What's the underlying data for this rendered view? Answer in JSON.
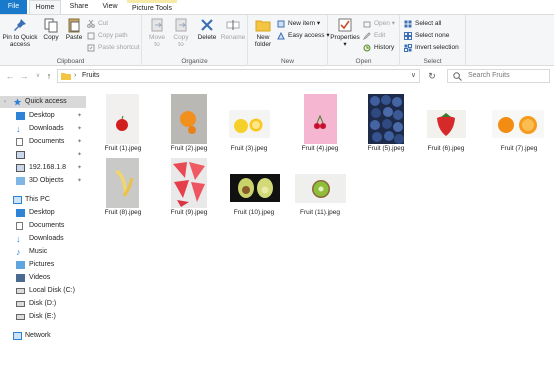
{
  "tabs": {
    "file": "File",
    "home": "Home",
    "share": "Share",
    "view": "View",
    "picture_tools": "Picture Tools"
  },
  "ribbon": {
    "clipboard": {
      "label": "Clipboard",
      "pin": "Pin to Quick access",
      "copy": "Copy",
      "paste": "Paste",
      "cut": "Cut",
      "copy_path": "Copy path",
      "paste_shortcut": "Paste shortcut"
    },
    "organize": {
      "label": "Organize",
      "move_to": "Move to",
      "copy_to": "Copy to",
      "delete": "Delete",
      "rename": "Rename"
    },
    "new": {
      "label": "New",
      "new_folder": "New folder",
      "new_item": "New item",
      "easy_access": "Easy access"
    },
    "open": {
      "label": "Open",
      "properties": "Properties",
      "open": "Open",
      "edit": "Edit",
      "history": "History"
    },
    "select": {
      "label": "Select",
      "select_all": "Select all",
      "select_none": "Select none",
      "invert_selection": "Invert selection"
    }
  },
  "address": {
    "path": "Fruits",
    "search_placeholder": "Search Fruits"
  },
  "nav_pane": {
    "quick_access": "Quick access",
    "quick_items": [
      "Desktop",
      "Downloads",
      "Documents",
      "",
      "192.168.1.8",
      "3D Objects"
    ],
    "this_pc": "This PC",
    "pc_items": [
      "Desktop",
      "Documents",
      "Downloads",
      "Music",
      "Pictures",
      "Videos",
      "Local Disk (C:)",
      "Disk (D:)",
      "Disk (E:)"
    ],
    "network": "Network"
  },
  "files": [
    "Fruit (1).jpeg",
    "Fruit (2).jpeg",
    "Fruit (3).jpeg",
    "Fruit (4).jpeg",
    "Fruit (5).jpeg",
    "Fruit (6).jpeg",
    "Fruit (7).jpeg",
    "Fruit (8).jpeg",
    "Fruit (9).jpeg",
    "Fruit (10).jpeg",
    "Fruit (11).jpeg"
  ],
  "colors": {
    "accent": "#1979ca",
    "folder": "#f4c542",
    "selection": "#d9d9d9"
  }
}
